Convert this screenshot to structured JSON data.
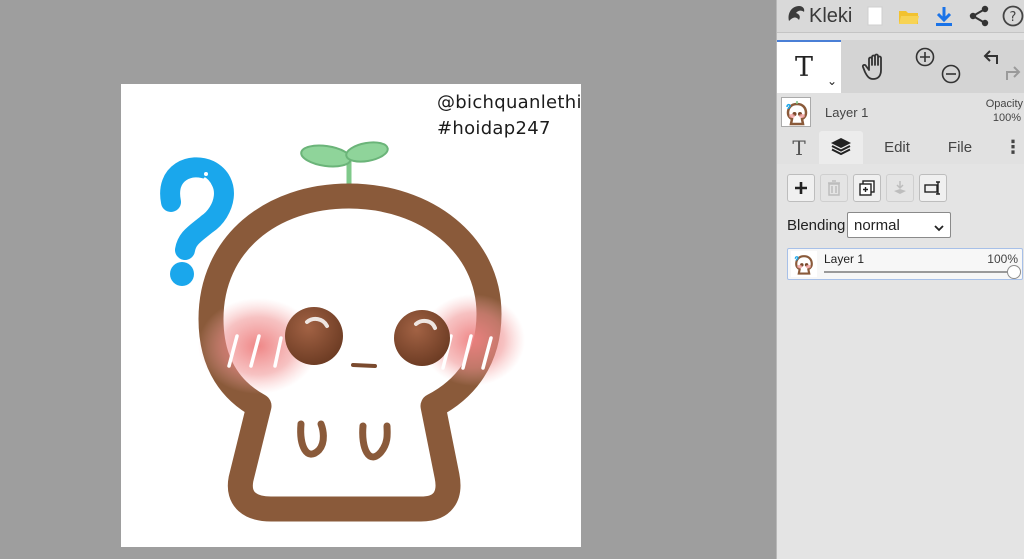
{
  "app": {
    "name": "Kleki",
    "icons": [
      "kleki-logo-icon",
      "new-file-icon",
      "open-folder-icon",
      "download-icon",
      "share-icon",
      "help-icon"
    ]
  },
  "colors": {
    "workspace": "#9e9e9e",
    "panel": "#e1e1e1",
    "accent": "#4a7fd6",
    "download": "#1a73e8",
    "folder": "#f2c230"
  },
  "canvas": {
    "watermark_line1": "@bichquanlethi",
    "watermark_line2": "#hoidap247",
    "artwork": "chibi-sprout-character-with-question-mark"
  },
  "tools": {
    "active": "text-tool",
    "items": [
      "text-tool",
      "hand-tool",
      "zoom-in",
      "zoom-out",
      "undo",
      "redo"
    ]
  },
  "layer_header": {
    "name": "Layer 1",
    "opacity_label": "Opacity",
    "opacity_value": "100%"
  },
  "tabs": {
    "text_glyph": "T",
    "layers": "layers",
    "edit": "Edit",
    "file": "File",
    "more": "⋮",
    "active": "layers"
  },
  "layers_panel": {
    "actions": [
      "add-layer",
      "delete-layer",
      "duplicate-layer",
      "merge-layer",
      "rename-layer"
    ],
    "blending_label": "Blending",
    "blending_value": "normal",
    "layers": [
      {
        "name": "Layer 1",
        "opacity": "100%",
        "opacity_fraction": 1.0
      }
    ]
  }
}
